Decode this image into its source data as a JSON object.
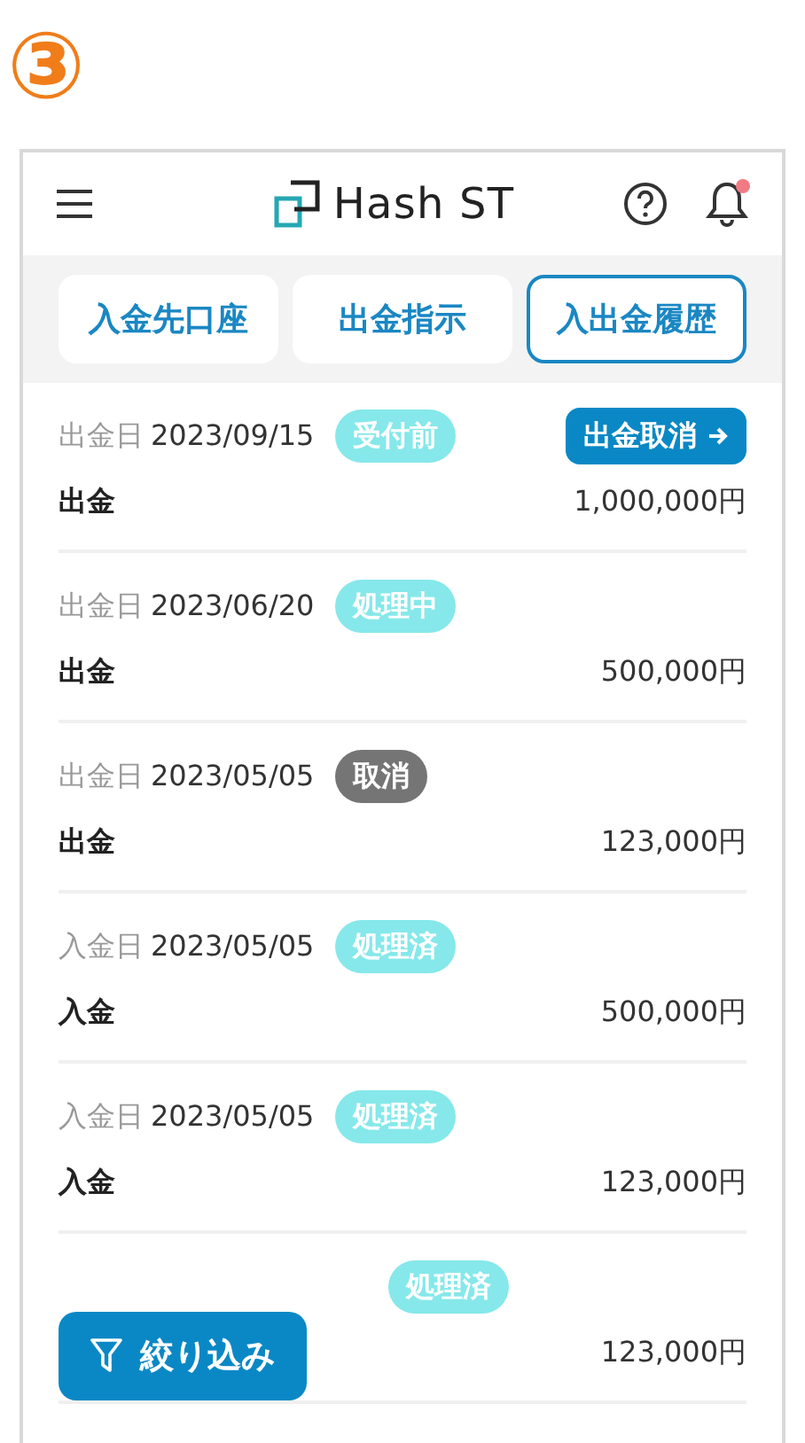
{
  "step_marker": "③",
  "header": {
    "brand": "Hash ST",
    "notification_unread": true
  },
  "tabs": [
    {
      "label": "入金先口座",
      "selected": false
    },
    {
      "label": "出金指示",
      "selected": false
    },
    {
      "label": "入出金履歴",
      "selected": true
    }
  ],
  "rows": [
    {
      "date_label": "出金日",
      "date": "2023/09/15",
      "status": "受付前",
      "color": "#86e8ea",
      "type": "出金",
      "amount": "1,000,000円",
      "action": "出金取消"
    },
    {
      "date_label": "出金日",
      "date": "2023/06/20",
      "status": "処理中",
      "color": "#86e8ea",
      "type": "出金",
      "amount": "500,000円"
    },
    {
      "date_label": "出金日",
      "date": "2023/05/05",
      "status": "取消",
      "color": "#757575",
      "type": "出金",
      "amount": "123,000円"
    },
    {
      "date_label": "入金日",
      "date": "2023/05/05",
      "status": "処理済",
      "color": "#86e8ea",
      "type": "入金",
      "amount": "500,000円"
    },
    {
      "date_label": "入金日",
      "date": "2023/05/05",
      "status": "処理済",
      "color": "#86e8ea",
      "type": "入金",
      "amount": "123,000円"
    },
    {
      "status": "処理済",
      "color": "#86e8ea",
      "amount": "123,000円"
    }
  ],
  "filter_button": "絞り込み"
}
